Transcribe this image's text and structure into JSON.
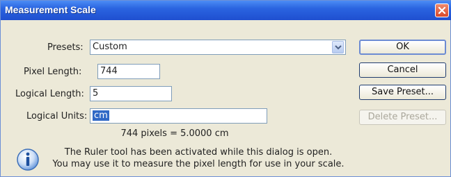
{
  "window": {
    "title": "Measurement Scale"
  },
  "presets": {
    "label": "Presets:",
    "value": "Custom"
  },
  "pixel_length": {
    "label": "Pixel Length:",
    "value": "744"
  },
  "logical_length": {
    "label": "Logical Length:",
    "value": "5"
  },
  "logical_units": {
    "label": "Logical Units:",
    "value": "cm"
  },
  "summary": "744 pixels = 5.0000 cm",
  "info": {
    "line1": "The Ruler tool has been activated while this dialog is open.",
    "line2": "You may use it to measure the pixel length for use in your scale."
  },
  "buttons": {
    "ok": "OK",
    "cancel": "Cancel",
    "save_preset": "Save Preset...",
    "delete_preset": "Delete Preset..."
  },
  "icons": {
    "close": "close-icon",
    "dropdown": "chevron-down-icon",
    "info": "info-icon"
  },
  "colors": {
    "titlebar": "#2a64e0",
    "selection": "#3169c6",
    "close": "#d8492a"
  }
}
